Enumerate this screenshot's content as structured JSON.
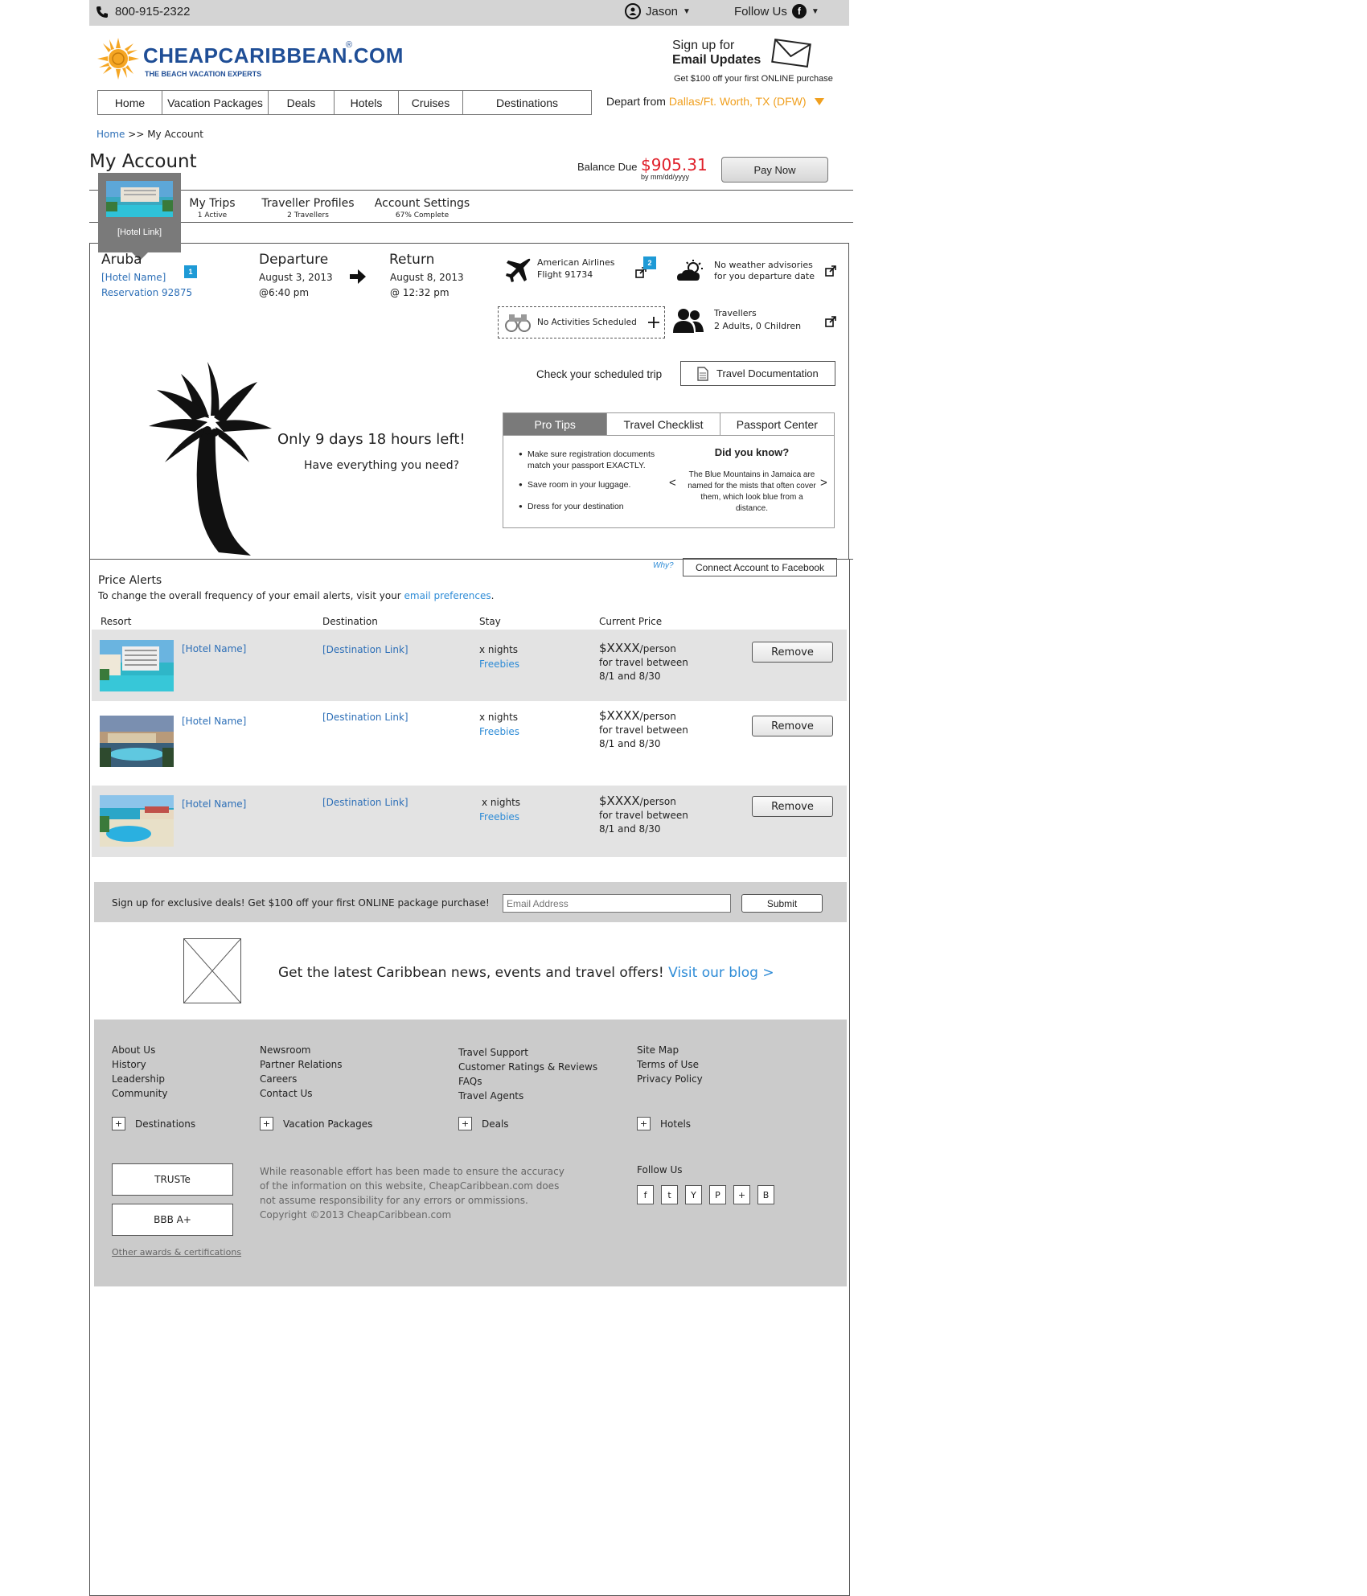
{
  "topbar": {
    "phone": "800-915-2322",
    "user_name": "Jason",
    "follow_label": "Follow Us",
    "fb_letter": "f"
  },
  "brand": {
    "name": "CHEAPCARIBBEAN.COM",
    "registered": "®",
    "tagline": "THE BEACH VACATION EXPERTS",
    "colors": {
      "brand_blue": "#1f4e96",
      "sun_orange": "#f5a623",
      "accent_orange": "#f0a020",
      "link_blue": "#2d6fb7",
      "price_red": "#e0202a",
      "badge_blue": "#1e9ad6"
    }
  },
  "email_signup": {
    "line1": "Sign up for",
    "line2": "Email Updates",
    "line3": "Get $100 off your first ONLINE purchase",
    "icon": "envelope-icon"
  },
  "nav": {
    "items": [
      "Home",
      "Vacation Packages",
      "Deals",
      "Hotels",
      "Cruises",
      "Destinations"
    ],
    "depart_label": "Depart from",
    "depart_city": "Dallas/Ft. Worth, TX (DFW)"
  },
  "breadcrumb": {
    "home": "Home",
    "separator": ">>",
    "current": "My Account"
  },
  "account": {
    "title": "My Account",
    "balance_label": "Balance Due",
    "balance_amount": "$905.31",
    "balance_due_by": "by mm/dd/yyyy",
    "pay_now": "Pay Now"
  },
  "account_tabs": [
    {
      "title": "My Trips",
      "sub": "1 Active"
    },
    {
      "title": "Traveller Profiles",
      "sub": "2 Travellers"
    },
    {
      "title": "Account Settings",
      "sub": "67% Complete"
    }
  ],
  "hotel_popup": {
    "link": "[Hotel Link]"
  },
  "trip": {
    "destination": "Aruba",
    "hotel_name": "[Hotel Name]",
    "reservation": "Reservation 92875",
    "hotel_badge": "1",
    "departure_label": "Departure",
    "departure_date": "August 3, 2013",
    "departure_time": "@6:40 pm",
    "return_label": "Return",
    "return_date": "August 8, 2013",
    "return_time": "@ 12:32 pm",
    "airline": "American Airlines",
    "flight": "Flight 91734",
    "flight_badge": "2",
    "weather_line1": "No weather advisories",
    "weather_line2": "for you departure date",
    "activities": "No Activities Scheduled",
    "travellers_label": "Travellers",
    "travellers_count": "2 Adults, 0 Children",
    "check_label": "Check your scheduled trip",
    "travel_doc": "Travel Documentation",
    "countdown": "Only 9 days 18 hours left!",
    "question": "Have everything you need?"
  },
  "tips": {
    "tabs": [
      "Pro Tips",
      "Travel Checklist",
      "Passport Center"
    ],
    "active_tab": "Pro Tips",
    "items": [
      "Make sure registration documents match your passport EXACTLY.",
      "Save room in your luggage.",
      "Dress for your destination"
    ],
    "did_you_know_title": "Did you know?",
    "did_you_know_text": "The Blue Mountains in Jamaica are named for the mists that often cover them, which look blue from a distance.",
    "prev": "<",
    "next": ">"
  },
  "price_alerts": {
    "why": "Why?",
    "fb_connect": "Connect Account to Facebook",
    "title": "Price Alerts",
    "desc_prefix": "To change the overall frequency of your email alerts, visit your ",
    "desc_link": "email preferences",
    "desc_suffix": ".",
    "columns": [
      "Resort",
      "Destination",
      "Stay",
      "Current Price"
    ],
    "rows": [
      {
        "hotel": "[Hotel Name]",
        "destination": "[Destination Link]",
        "nights": "x nights",
        "freebies": "Freebies",
        "price": "$XXXX",
        "per": "/person",
        "line2": "for travel between",
        "line3": "8/1 and 8/30",
        "remove": "Remove"
      },
      {
        "hotel": "[Hotel Name]",
        "destination": "[Destination Link]",
        "nights": "x nights",
        "freebies": "Freebies",
        "price": "$XXXX",
        "per": "/person",
        "line2": "for travel between",
        "line3": "8/1 and 8/30",
        "remove": "Remove"
      },
      {
        "hotel": "[Hotel Name]",
        "destination": "[Destination Link]",
        "nights": "x nights",
        "freebies": "Freebies",
        "price": "$XXXX",
        "per": "/person",
        "line2": "for travel between",
        "line3": "8/1 and 8/30",
        "remove": "Remove"
      }
    ]
  },
  "signup_bar": {
    "text": "Sign up for exclusive deals! Get $100 off your first ONLINE package purchase!",
    "placeholder": "Email Address",
    "submit": "Submit"
  },
  "blog": {
    "text": "Get the latest Caribbean news, events and travel offers!",
    "link": "Visit our blog >"
  },
  "footer": {
    "col1": [
      "About Us",
      "History",
      "Leadership",
      "Community"
    ],
    "col2": [
      "Newsroom",
      "Partner Relations",
      "Careers",
      "Contact Us"
    ],
    "col3": [
      "Travel Support",
      "Customer Ratings & Reviews",
      "FAQs",
      "Travel Agents"
    ],
    "col4": [
      "Site Map",
      "Terms of Use",
      "Privacy Policy"
    ],
    "expanders": [
      "Destinations",
      "Vacation Packages",
      "Deals",
      "Hotels"
    ],
    "plus": "+",
    "awards": [
      "TRUSTe",
      "BBB A+"
    ],
    "other_awards": "Other awards & certifications",
    "disclaimer": "While reasonable effort has been made to ensure the accuracy of the information on this website, CheapCaribbean.com does not assume responsibility for any errors or ommissions.",
    "copyright": "Copyright ©2013 CheapCaribbean.com",
    "follow_label": "Follow Us",
    "social": [
      "f",
      "t",
      "Y",
      "P",
      "+",
      "B"
    ]
  }
}
